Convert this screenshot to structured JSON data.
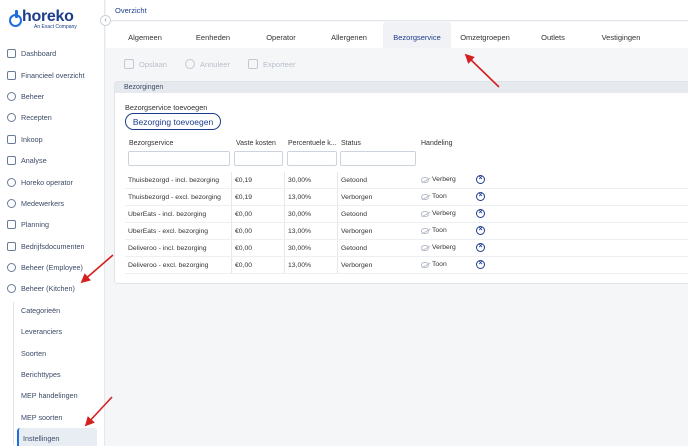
{
  "brand": {
    "name": "horeko",
    "tagline": "An Exact Company",
    "collapse_glyph": "‹"
  },
  "colors": {
    "primary": "#1d3c8c",
    "accent": "#1d6fe0",
    "annotation": "#d42020"
  },
  "sidebar": {
    "items": [
      {
        "label": "Dashboard",
        "icon": "grid-icon"
      },
      {
        "label": "Financieel overzicht",
        "icon": "chart-icon"
      },
      {
        "label": "Beheer",
        "icon": "users-icon"
      },
      {
        "label": "Recepten",
        "icon": "chef-hat-icon"
      },
      {
        "label": "Inkoop",
        "icon": "clipboard-icon"
      },
      {
        "label": "Analyse",
        "icon": "analytics-icon"
      },
      {
        "label": "Horeko operator",
        "icon": "operator-icon"
      },
      {
        "label": "Medewerkers",
        "icon": "people-icon"
      },
      {
        "label": "Planning",
        "icon": "calendar-icon"
      },
      {
        "label": "Bedrijfsdocumenten",
        "icon": "folder-icon"
      },
      {
        "label": "Beheer (Employee)",
        "icon": "employee-icon"
      },
      {
        "label": "Beheer (Kitchen)",
        "icon": "kitchen-icon"
      }
    ],
    "subitems": [
      {
        "label": "Categorieën"
      },
      {
        "label": "Leveranciers"
      },
      {
        "label": "Soorten"
      },
      {
        "label": "Berichttypes"
      },
      {
        "label": "MEP handelingen"
      },
      {
        "label": "MEP soorten"
      },
      {
        "label": "Instellingen"
      }
    ]
  },
  "breadcrumb": "Overzicht",
  "tabs": [
    "Algemeen",
    "Eenheden",
    "Operator",
    "Allergenen",
    "Bezorgservice",
    "Omzetgroepen",
    "Outlets",
    "Vestigingen"
  ],
  "active_tab": "Bezorgservice",
  "toolbar": {
    "save": "Opslaan",
    "cancel": "Annuleer",
    "export": "Exporteer"
  },
  "panel": {
    "title": "Bezorgingen",
    "add_label": "Bezorgservice toevoegen",
    "add_button": "Bezorging toevoegen",
    "columns": [
      "Bezorgservice",
      "Vaste kosten",
      "Percentuele k...",
      "Status",
      "Handeling"
    ],
    "rows": [
      {
        "name": "Thuisbezorgd - incl. bezorging",
        "cost": "€0,19",
        "pct": "30,00%",
        "status": "Getoond",
        "action": "Verberg"
      },
      {
        "name": "Thuisbezorgd - excl. bezorging",
        "cost": "€0,19",
        "pct": "13,00%",
        "status": "Verborgen",
        "action": "Toon"
      },
      {
        "name": "UberEats - incl. bezorging",
        "cost": "€0,00",
        "pct": "30,00%",
        "status": "Getoond",
        "action": "Verberg"
      },
      {
        "name": "UberEats - excl. bezorging",
        "cost": "€0,00",
        "pct": "13,00%",
        "status": "Verborgen",
        "action": "Toon"
      },
      {
        "name": "Deliveroo - incl. bezorging",
        "cost": "€0,00",
        "pct": "30,00%",
        "status": "Getoond",
        "action": "Verberg"
      },
      {
        "name": "Deliveroo - excl. bezorging",
        "cost": "€0,00",
        "pct": "13,00%",
        "status": "Verborgen",
        "action": "Toon"
      }
    ]
  }
}
